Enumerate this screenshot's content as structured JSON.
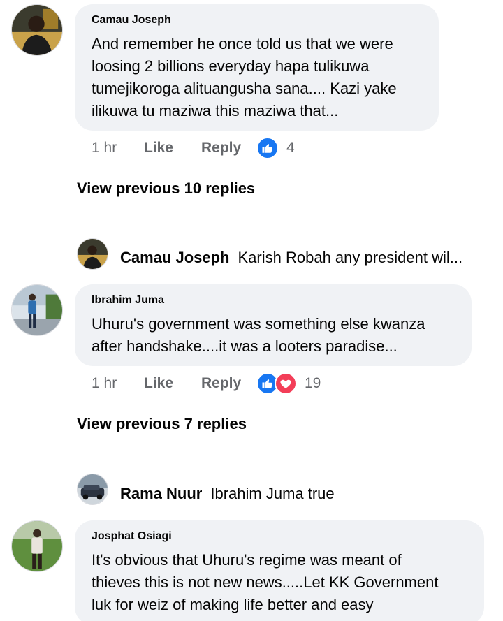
{
  "comments": [
    {
      "author": "Camau Joseph",
      "lines": [
        "And remember he once told us that we were",
        "loosing 2 billions everyday hapa tulikuwa",
        "tumejikoroga alituangusha sana.... Kazi yake",
        "ilikuwa tu maziwa this maziwa that..."
      ],
      "time": "1 hr",
      "like_label": "Like",
      "reply_label": "Reply",
      "reaction_count": "4",
      "reactions": [
        "like-icon"
      ]
    },
    {
      "author": "Ibrahim Juma",
      "lines": [
        "Uhuru's government was something else kwanza",
        "after handshake....it was a looters paradise..."
      ],
      "time": "1 hr",
      "like_label": "Like",
      "reply_label": "Reply",
      "reaction_count": "19",
      "reactions": [
        "like-icon",
        "love-icon"
      ]
    },
    {
      "author": "Josphat Osiagi",
      "lines": [
        "It's obvious that Uhuru's regime was meant of",
        "thieves this is not new news.....Let KK Government",
        "luk for weiz of making life better and easy"
      ]
    }
  ],
  "view_previous": [
    "View previous 10 replies",
    "View previous 7 replies"
  ],
  "replies": [
    {
      "author": "Camau Joseph",
      "text": "Karish Robah any president wil..."
    },
    {
      "author": "Rama Nuur",
      "text": "Ibrahim Juma true"
    }
  ],
  "colors": {
    "bubble": "#f0f2f5",
    "muted_text": "#65676b",
    "like_blue": "#1877f2",
    "love_red": "#f33e58"
  }
}
